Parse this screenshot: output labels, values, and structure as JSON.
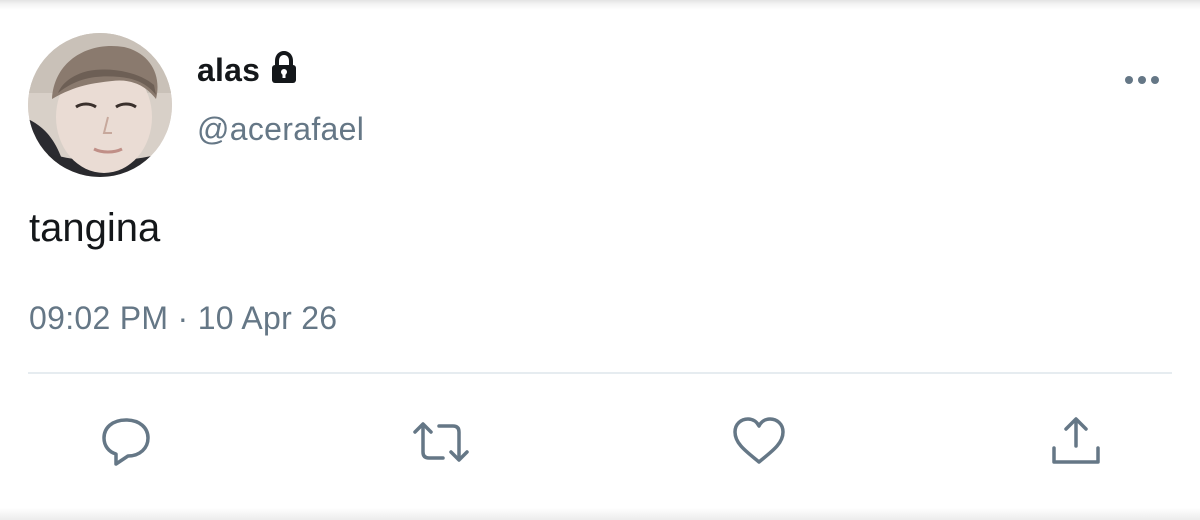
{
  "tweet": {
    "display_name": "alas",
    "handle": "@acerafael",
    "text": "tangina",
    "timestamp": "09:02 PM · 10 Apr 26",
    "protected": true
  },
  "icons": {
    "lock": "lock-icon",
    "more": "more-dots-icon",
    "reply": "reply-icon",
    "retweet": "retweet-icon",
    "like": "heart-icon",
    "share": "share-icon"
  },
  "colors": {
    "primary_text": "#14171a",
    "secondary_text": "#657786",
    "divider": "#e6ecf0",
    "icon": "#657786"
  }
}
